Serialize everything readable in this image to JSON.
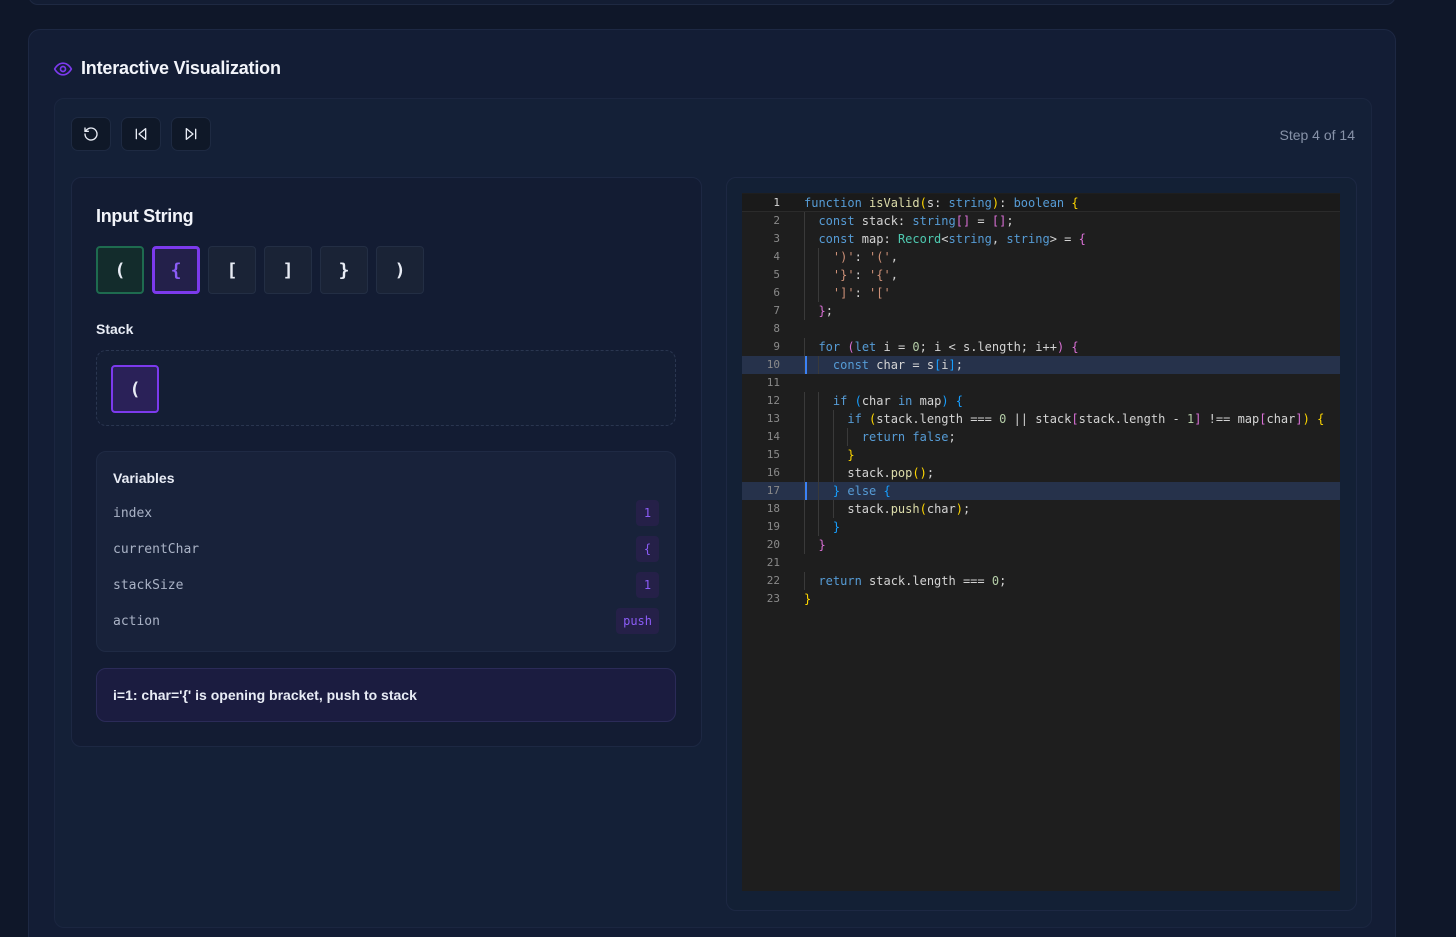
{
  "header": {
    "title": "Interactive Visualization",
    "icon": "eye-icon"
  },
  "toolbar": {
    "buttons": [
      {
        "name": "reset",
        "icon": "rotate-ccw-icon"
      },
      {
        "name": "step-back",
        "icon": "skip-back-icon"
      },
      {
        "name": "step-forward",
        "icon": "skip-forward-icon"
      }
    ]
  },
  "step_indicator": "Step 4 of 14",
  "input": {
    "title": "Input String",
    "chars": [
      "(",
      "{",
      "[",
      "]",
      "}",
      ")"
    ],
    "processed_index": 0,
    "active_index": 1
  },
  "stack": {
    "label": "Stack",
    "items": [
      "("
    ]
  },
  "variables": {
    "title": "Variables",
    "rows": [
      {
        "name": "index",
        "value": "1"
      },
      {
        "name": "currentChar",
        "value": "{"
      },
      {
        "name": "stackSize",
        "value": "1"
      },
      {
        "name": "action",
        "value": "push"
      }
    ]
  },
  "message": "i=1: char='{' is opening bracket, push to stack",
  "code": {
    "highlighted_lines": [
      10,
      17
    ],
    "lines": [
      "function isValid(s: string): boolean {",
      "  const stack: string[] = [];",
      "  const map: Record<string, string> = {",
      "    ')': '(',",
      "    '}': '{',",
      "    ']': '['",
      "  };",
      "",
      "  for (let i = 0; i < s.length; i++) {",
      "    const char = s[i];",
      "",
      "    if (char in map) {",
      "      if (stack.length === 0 || stack[stack.length - 1] !== map[char]) {",
      "        return false;",
      "      }",
      "      stack.pop();",
      "    } else {",
      "      stack.push(char);",
      "    }",
      "  }",
      "",
      "  return stack.length === 0;",
      "}"
    ]
  },
  "colors": {
    "accent": "#7c3aed",
    "highlight": "#3b82f6",
    "background": "#0f1729",
    "processed": "#1e6b4f"
  }
}
